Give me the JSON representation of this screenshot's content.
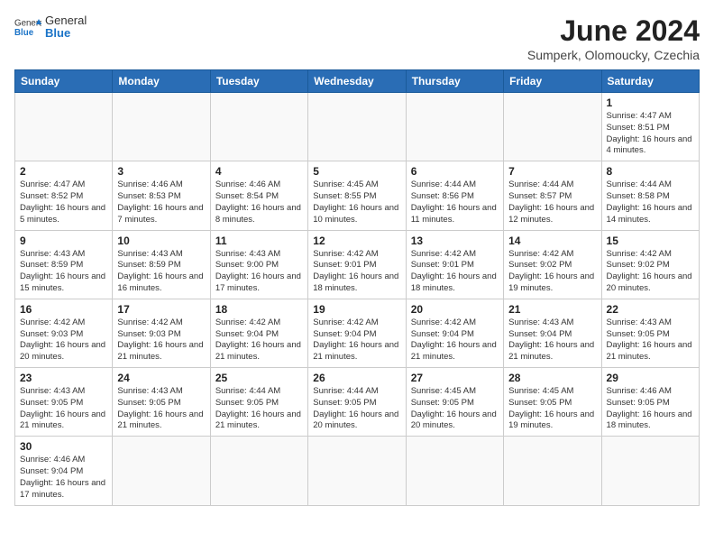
{
  "header": {
    "logo_general": "General",
    "logo_blue": "Blue",
    "month_title": "June 2024",
    "subtitle": "Sumperk, Olomoucky, Czechia"
  },
  "weekdays": [
    "Sunday",
    "Monday",
    "Tuesday",
    "Wednesday",
    "Thursday",
    "Friday",
    "Saturday"
  ],
  "weeks": [
    [
      {
        "day": "",
        "info": ""
      },
      {
        "day": "",
        "info": ""
      },
      {
        "day": "",
        "info": ""
      },
      {
        "day": "",
        "info": ""
      },
      {
        "day": "",
        "info": ""
      },
      {
        "day": "",
        "info": ""
      },
      {
        "day": "1",
        "info": "Sunrise: 4:47 AM\nSunset: 8:51 PM\nDaylight: 16 hours and 4 minutes."
      }
    ],
    [
      {
        "day": "2",
        "info": "Sunrise: 4:47 AM\nSunset: 8:52 PM\nDaylight: 16 hours and 5 minutes."
      },
      {
        "day": "3",
        "info": "Sunrise: 4:46 AM\nSunset: 8:53 PM\nDaylight: 16 hours and 7 minutes."
      },
      {
        "day": "4",
        "info": "Sunrise: 4:46 AM\nSunset: 8:54 PM\nDaylight: 16 hours and 8 minutes."
      },
      {
        "day": "5",
        "info": "Sunrise: 4:45 AM\nSunset: 8:55 PM\nDaylight: 16 hours and 10 minutes."
      },
      {
        "day": "6",
        "info": "Sunrise: 4:44 AM\nSunset: 8:56 PM\nDaylight: 16 hours and 11 minutes."
      },
      {
        "day": "7",
        "info": "Sunrise: 4:44 AM\nSunset: 8:57 PM\nDaylight: 16 hours and 12 minutes."
      },
      {
        "day": "8",
        "info": "Sunrise: 4:44 AM\nSunset: 8:58 PM\nDaylight: 16 hours and 14 minutes."
      }
    ],
    [
      {
        "day": "9",
        "info": "Sunrise: 4:43 AM\nSunset: 8:59 PM\nDaylight: 16 hours and 15 minutes."
      },
      {
        "day": "10",
        "info": "Sunrise: 4:43 AM\nSunset: 8:59 PM\nDaylight: 16 hours and 16 minutes."
      },
      {
        "day": "11",
        "info": "Sunrise: 4:43 AM\nSunset: 9:00 PM\nDaylight: 16 hours and 17 minutes."
      },
      {
        "day": "12",
        "info": "Sunrise: 4:42 AM\nSunset: 9:01 PM\nDaylight: 16 hours and 18 minutes."
      },
      {
        "day": "13",
        "info": "Sunrise: 4:42 AM\nSunset: 9:01 PM\nDaylight: 16 hours and 18 minutes."
      },
      {
        "day": "14",
        "info": "Sunrise: 4:42 AM\nSunset: 9:02 PM\nDaylight: 16 hours and 19 minutes."
      },
      {
        "day": "15",
        "info": "Sunrise: 4:42 AM\nSunset: 9:02 PM\nDaylight: 16 hours and 20 minutes."
      }
    ],
    [
      {
        "day": "16",
        "info": "Sunrise: 4:42 AM\nSunset: 9:03 PM\nDaylight: 16 hours and 20 minutes."
      },
      {
        "day": "17",
        "info": "Sunrise: 4:42 AM\nSunset: 9:03 PM\nDaylight: 16 hours and 21 minutes."
      },
      {
        "day": "18",
        "info": "Sunrise: 4:42 AM\nSunset: 9:04 PM\nDaylight: 16 hours and 21 minutes."
      },
      {
        "day": "19",
        "info": "Sunrise: 4:42 AM\nSunset: 9:04 PM\nDaylight: 16 hours and 21 minutes."
      },
      {
        "day": "20",
        "info": "Sunrise: 4:42 AM\nSunset: 9:04 PM\nDaylight: 16 hours and 21 minutes."
      },
      {
        "day": "21",
        "info": "Sunrise: 4:43 AM\nSunset: 9:04 PM\nDaylight: 16 hours and 21 minutes."
      },
      {
        "day": "22",
        "info": "Sunrise: 4:43 AM\nSunset: 9:05 PM\nDaylight: 16 hours and 21 minutes."
      }
    ],
    [
      {
        "day": "23",
        "info": "Sunrise: 4:43 AM\nSunset: 9:05 PM\nDaylight: 16 hours and 21 minutes."
      },
      {
        "day": "24",
        "info": "Sunrise: 4:43 AM\nSunset: 9:05 PM\nDaylight: 16 hours and 21 minutes."
      },
      {
        "day": "25",
        "info": "Sunrise: 4:44 AM\nSunset: 9:05 PM\nDaylight: 16 hours and 21 minutes."
      },
      {
        "day": "26",
        "info": "Sunrise: 4:44 AM\nSunset: 9:05 PM\nDaylight: 16 hours and 20 minutes."
      },
      {
        "day": "27",
        "info": "Sunrise: 4:45 AM\nSunset: 9:05 PM\nDaylight: 16 hours and 20 minutes."
      },
      {
        "day": "28",
        "info": "Sunrise: 4:45 AM\nSunset: 9:05 PM\nDaylight: 16 hours and 19 minutes."
      },
      {
        "day": "29",
        "info": "Sunrise: 4:46 AM\nSunset: 9:05 PM\nDaylight: 16 hours and 18 minutes."
      }
    ],
    [
      {
        "day": "30",
        "info": "Sunrise: 4:46 AM\nSunset: 9:04 PM\nDaylight: 16 hours and 17 minutes."
      },
      {
        "day": "",
        "info": ""
      },
      {
        "day": "",
        "info": ""
      },
      {
        "day": "",
        "info": ""
      },
      {
        "day": "",
        "info": ""
      },
      {
        "day": "",
        "info": ""
      },
      {
        "day": "",
        "info": ""
      }
    ]
  ]
}
